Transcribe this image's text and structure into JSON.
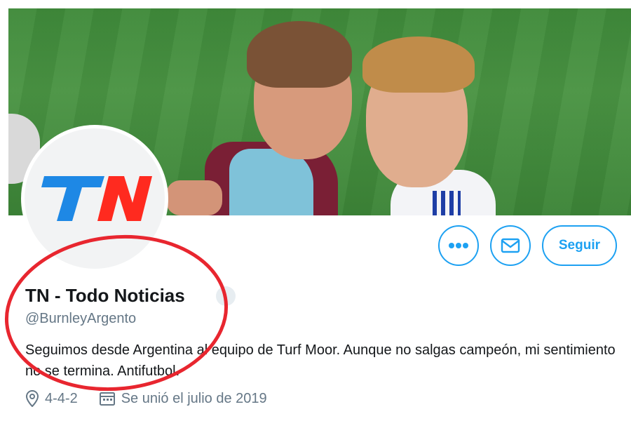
{
  "profile": {
    "display_name": "TN - Todo Noticias",
    "handle": "@BurnleyArgento",
    "bio": "Seguimos desde Argentina al equipo de Turf Moor. Aunque no salgas campeón, mi sentimiento no se termina. Antifutbol.",
    "location": "4-4-2",
    "joined": "Se unió el julio de 2019",
    "avatar_logo_text": "TN"
  },
  "actions": {
    "more_icon": "more-dots-icon",
    "message_icon": "envelope-icon",
    "follow_label": "Seguir"
  },
  "colors": {
    "accent": "#1da1f2",
    "tn_blue": "#1e88e5",
    "tn_red": "#ff2a1f",
    "annotation_red": "#e8262f"
  }
}
